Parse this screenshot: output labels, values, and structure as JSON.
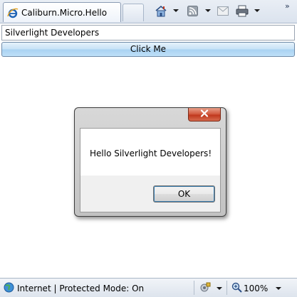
{
  "browser": {
    "tab_title": "Caliburn.Micro.Hello",
    "toolbar_icons": [
      "ie-page-icon",
      "home-icon",
      "rss-feed-icon",
      "mail-icon",
      "print-icon"
    ],
    "overflow_chevrons": "»"
  },
  "page": {
    "name_input_value": "Silverlight Developers",
    "click_button_label": "Click Me"
  },
  "dialog": {
    "message": "Hello Silverlight Developers!",
    "ok_label": "OK",
    "close_glyph": "✕"
  },
  "statusbar": {
    "zone_text": "Internet | Protected Mode: On",
    "zoom_text": "100%"
  },
  "colors": {
    "button_blue": "#bfe0f8",
    "close_red": "#c0371c",
    "ie_blue": "#1e63b5"
  }
}
